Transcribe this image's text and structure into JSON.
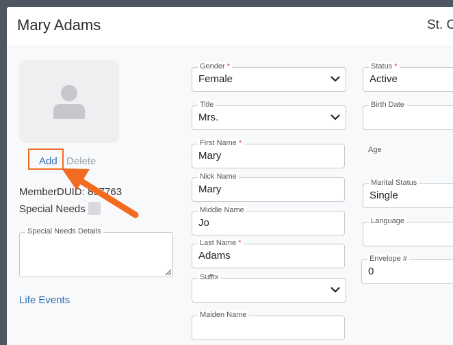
{
  "header": {
    "title": "Mary Adams",
    "org": "St. C"
  },
  "photo": {
    "add_label": "Add",
    "delete_label": "Delete"
  },
  "member": {
    "id_text": "MemberDUID: 857763",
    "special_needs_label": "Special Needs",
    "special_needs_details_label": "Special Needs Details",
    "life_events_label": "Life Events"
  },
  "fields": {
    "gender": {
      "label": "Gender",
      "required": "*",
      "value": "Female"
    },
    "title": {
      "label": "Title",
      "value": "Mrs."
    },
    "first_name": {
      "label": "First Name",
      "required": "*",
      "value": "Mary"
    },
    "nick_name": {
      "label": "Nick Name",
      "value": "Mary"
    },
    "middle_name": {
      "label": "Middle Name",
      "value": "Jo"
    },
    "last_name": {
      "label": "Last Name",
      "required": "*",
      "value": "Adams"
    },
    "suffix": {
      "label": "Suffix",
      "value": ""
    },
    "maiden_name": {
      "label": "Maiden Name",
      "value": ""
    },
    "status": {
      "label": "Status",
      "required": "*",
      "value": "Active"
    },
    "birth_date": {
      "label": "Birth Date",
      "value": ""
    },
    "age": {
      "label": "Age"
    },
    "marital_status": {
      "label": "Marital Status",
      "value": "Single"
    },
    "language": {
      "label": "Language",
      "value": ""
    },
    "envelope": {
      "label": "Envelope #",
      "value": "0"
    }
  },
  "colors": {
    "accent_link": "#2f6db5",
    "highlight": "#f26b21",
    "required": "#d23b3b"
  },
  "icons": [
    "person-placeholder-icon",
    "chevron-down-icon",
    "resize-handle-icon",
    "callout-arrow-icon"
  ]
}
